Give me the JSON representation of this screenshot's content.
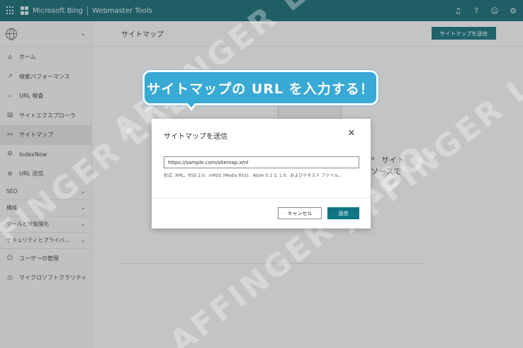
{
  "header": {
    "brand": "Microsoft Bing",
    "product": "Webmaster Tools",
    "icons": [
      "waffle-icon",
      "microsoft-logo",
      "bell-icon",
      "help-icon",
      "smiley-icon",
      "settings-icon"
    ]
  },
  "sidebar": {
    "items": [
      {
        "label": "ホーム",
        "icon": "home-icon"
      },
      {
        "label": "検索パフォーマンス",
        "icon": "trend-icon"
      },
      {
        "label": "URL 検査",
        "icon": "search-icon"
      },
      {
        "label": "サイトエクスプローラ",
        "icon": "document-icon"
      },
      {
        "label": "サイトマップ",
        "icon": "sitemap-icon",
        "active": true
      },
      {
        "label": "IndexNow",
        "icon": "gear-icon"
      },
      {
        "label": "URL 送信",
        "icon": "globe-icon"
      }
    ],
    "groups": [
      {
        "label": "SEO"
      },
      {
        "label": "構成"
      },
      {
        "label": "ツールと機能強化"
      },
      {
        "label": "セキュリティとプライバ..."
      }
    ],
    "bottom_items": [
      {
        "label": "ユーザーの管理",
        "icon": "users-icon"
      },
      {
        "label": "マイクロソフトクラリティ",
        "icon": "clarity-icon"
      }
    ]
  },
  "main": {
    "title": "サイトマップ",
    "submit_button": "サイトマップを送信",
    "bg_text_1": "サイト",
    "bg_text_2": "ソースで",
    "bg_text_3": "o"
  },
  "callout": {
    "text": "サイトマップの URL を入力する！"
  },
  "watermark": {
    "text": "AFFINGER LABO."
  },
  "modal": {
    "title": "サイトマップを送信",
    "url_value": "https://sample.com/sitemap.xml",
    "hint": "形式: XML、RSS 2.0、mRSS (Media RSS)、Atom 0.3 と 1.0、およびテキスト ファイル。",
    "cancel_label": "キャンセル",
    "submit_label": "送信"
  },
  "colors": {
    "topbar": "#0f6470",
    "primary_button": "#0f7584",
    "callout": "#39a9d6"
  }
}
